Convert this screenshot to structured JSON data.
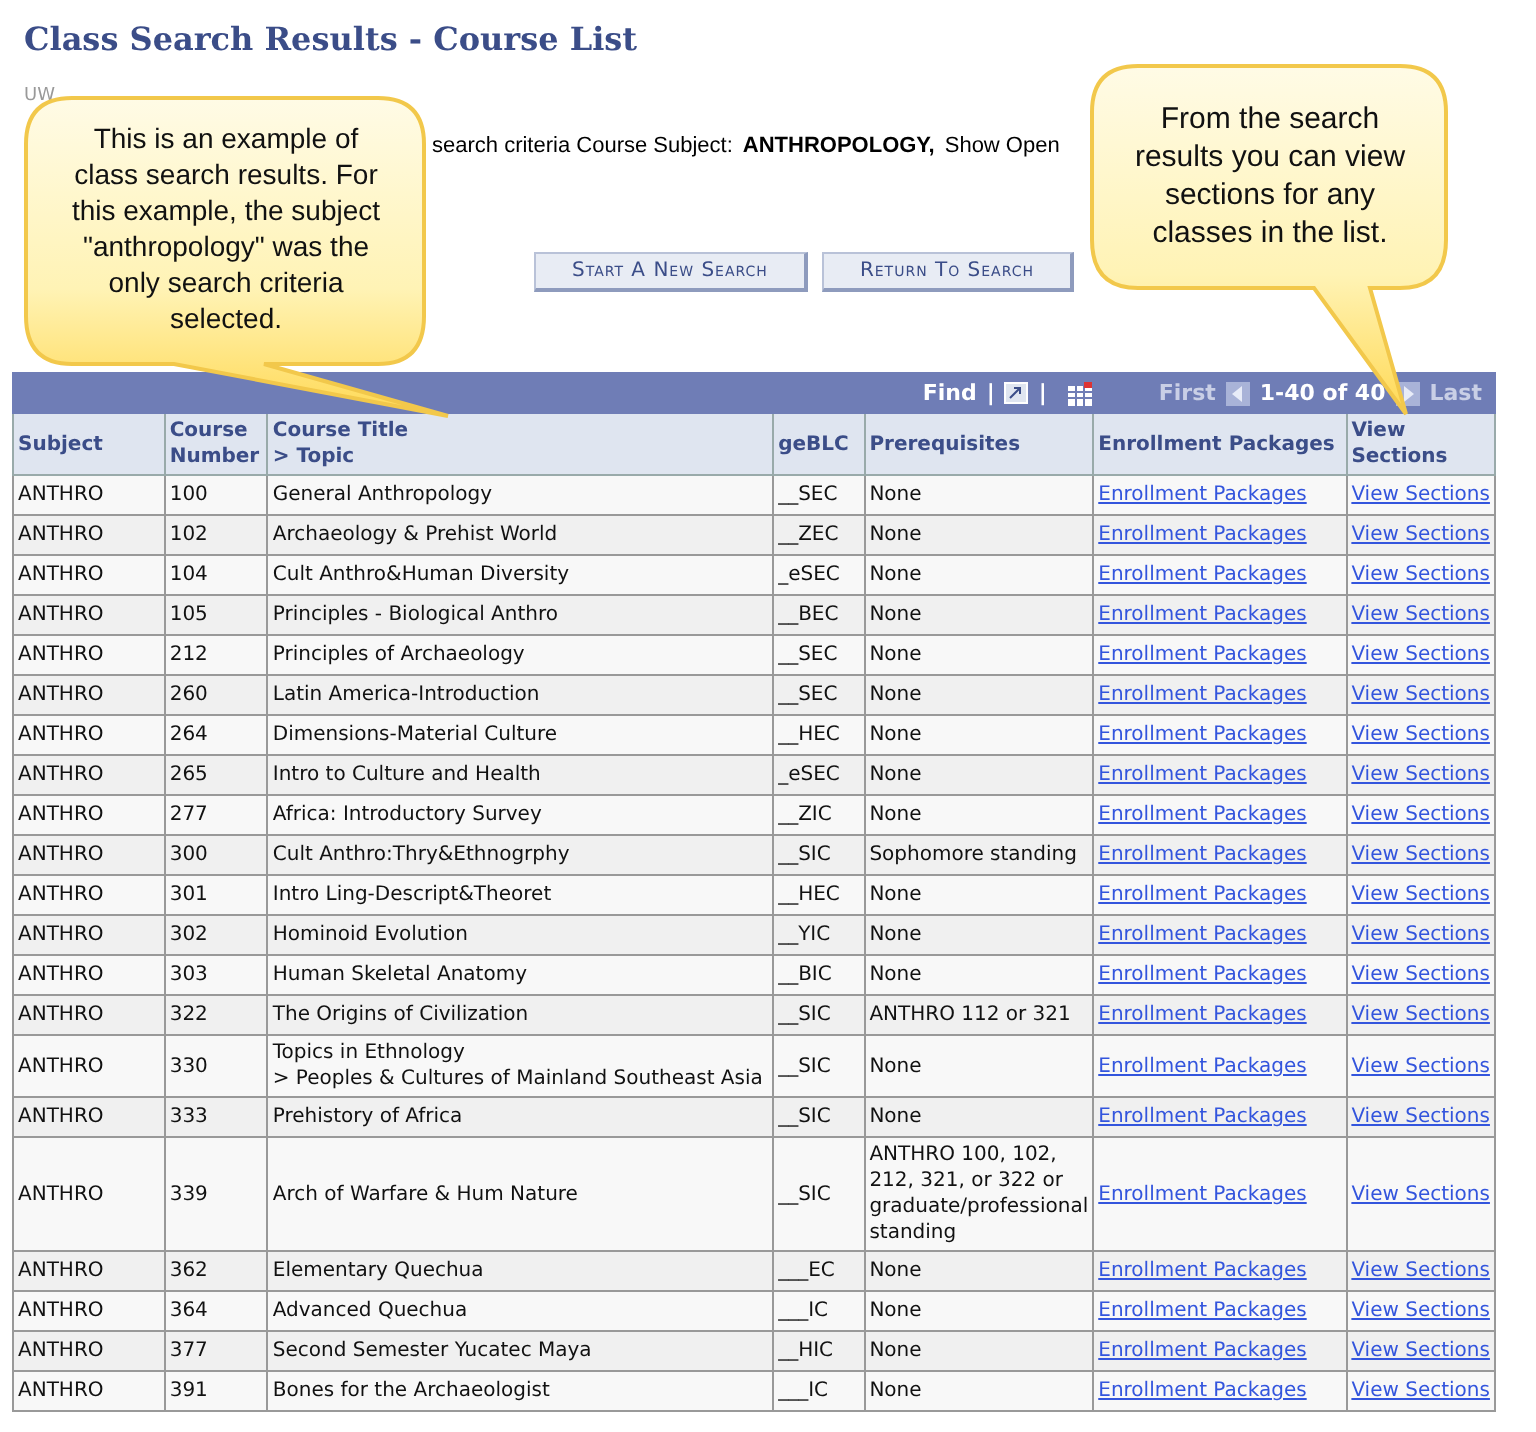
{
  "page": {
    "title": "Class Search Results - Course List",
    "institution": "UW",
    "criteria": {
      "label": "search criteria Course Subject:",
      "value": "ANTHROPOLOGY,",
      "extra": "Show Open"
    }
  },
  "buttons": [
    {
      "label": "Start A New Search"
    },
    {
      "label": "Return To Search"
    }
  ],
  "table": {
    "nav": {
      "find": "Find",
      "separators": [
        "|",
        "|"
      ],
      "first": "First",
      "range": "1-40 of 40",
      "last": "Last"
    },
    "columns": [
      {
        "label": "Subject"
      },
      {
        "label": "Course Number"
      },
      {
        "label": "Course Title",
        "sub": "> Topic"
      },
      {
        "label": "geBLC"
      },
      {
        "label": "Prerequisites"
      },
      {
        "label": "Enrollment Packages"
      },
      {
        "label": "View Sections"
      }
    ],
    "rows": [
      {
        "subject": "ANTHRO",
        "number": "100",
        "title": "General Anthropology",
        "geblc": "__SEC",
        "prereq": "None",
        "links": [
          "Enrollment Packages",
          "View Sections"
        ]
      },
      {
        "subject": "ANTHRO",
        "number": "102",
        "title": "Archaeology & Prehist World",
        "geblc": "__ZEC",
        "prereq": "None",
        "links": [
          "Enrollment Packages",
          "View Sections"
        ]
      },
      {
        "subject": "ANTHRO",
        "number": "104",
        "title": "Cult Anthro&Human Diversity",
        "geblc": "_eSEC",
        "prereq": "None",
        "links": [
          "Enrollment Packages",
          "View Sections"
        ]
      },
      {
        "subject": "ANTHRO",
        "number": "105",
        "title": "Principles - Biological Anthro",
        "geblc": "__BEC",
        "prereq": "None",
        "links": [
          "Enrollment Packages",
          "View Sections"
        ]
      },
      {
        "subject": "ANTHRO",
        "number": "212",
        "title": "Principles of Archaeology",
        "geblc": "__SEC",
        "prereq": "None",
        "links": [
          "Enrollment Packages",
          "View Sections"
        ]
      },
      {
        "subject": "ANTHRO",
        "number": "260",
        "title": "Latin America-Introduction",
        "geblc": "__SEC",
        "prereq": "None",
        "links": [
          "Enrollment Packages",
          "View Sections"
        ]
      },
      {
        "subject": "ANTHRO",
        "number": "264",
        "title": "Dimensions-Material Culture",
        "geblc": "__HEC",
        "prereq": "None",
        "links": [
          "Enrollment Packages",
          "View Sections"
        ]
      },
      {
        "subject": "ANTHRO",
        "number": "265",
        "title": "Intro to Culture and Health",
        "geblc": "_eSEC",
        "prereq": "None",
        "links": [
          "Enrollment Packages",
          "View Sections"
        ]
      },
      {
        "subject": "ANTHRO",
        "number": "277",
        "title": "Africa: Introductory Survey",
        "geblc": "__ZIC",
        "prereq": "None",
        "links": [
          "Enrollment Packages",
          "View Sections"
        ]
      },
      {
        "subject": "ANTHRO",
        "number": "300",
        "title": "Cult Anthro:Thry&Ethnogrphy",
        "geblc": "__SIC",
        "prereq": "Sophomore standing",
        "links": [
          "Enrollment Packages",
          "View Sections"
        ]
      },
      {
        "subject": "ANTHRO",
        "number": "301",
        "title": "Intro Ling-Descript&Theoret",
        "geblc": "__HEC",
        "prereq": "None",
        "links": [
          "Enrollment Packages",
          "View Sections"
        ]
      },
      {
        "subject": "ANTHRO",
        "number": "302",
        "title": "Hominoid Evolution",
        "geblc": "__YIC",
        "prereq": "None",
        "links": [
          "Enrollment Packages",
          "View Sections"
        ]
      },
      {
        "subject": "ANTHRO",
        "number": "303",
        "title": "Human Skeletal Anatomy",
        "geblc": "__BIC",
        "prereq": "None",
        "links": [
          "Enrollment Packages",
          "View Sections"
        ]
      },
      {
        "subject": "ANTHRO",
        "number": "322",
        "title": "The Origins of Civilization",
        "geblc": "__SIC",
        "prereq": "ANTHRO 112 or 321",
        "links": [
          "Enrollment Packages",
          "View Sections"
        ]
      },
      {
        "subject": "ANTHRO",
        "number": "330",
        "title": "Topics in Ethnology",
        "topic": "> Peoples & Cultures of Mainland Southeast Asia",
        "geblc": "__SIC",
        "prereq": "None",
        "links": [
          "Enrollment Packages",
          "View Sections"
        ]
      },
      {
        "subject": "ANTHRO",
        "number": "333",
        "title": "Prehistory of Africa",
        "geblc": "__SIC",
        "prereq": "None",
        "links": [
          "Enrollment Packages",
          "View Sections"
        ]
      },
      {
        "subject": "ANTHRO",
        "number": "339",
        "title": "Arch of Warfare & Hum Nature",
        "geblc": "__SIC",
        "prereq": "ANTHRO 100, 102, 212, 321, or 322 or graduate/professional standing",
        "links": [
          "Enrollment Packages",
          "View Sections"
        ]
      },
      {
        "subject": "ANTHRO",
        "number": "362",
        "title": "Elementary Quechua",
        "geblc": "___EC",
        "prereq": "None",
        "links": [
          "Enrollment Packages",
          "View Sections"
        ]
      },
      {
        "subject": "ANTHRO",
        "number": "364",
        "title": "Advanced Quechua",
        "geblc": "___IC",
        "prereq": "None",
        "links": [
          "Enrollment Packages",
          "View Sections"
        ]
      },
      {
        "subject": "ANTHRO",
        "number": "377",
        "title": "Second Semester Yucatec Maya",
        "geblc": "__HIC",
        "prereq": "None",
        "links": [
          "Enrollment Packages",
          "View Sections"
        ]
      },
      {
        "subject": "ANTHRO",
        "number": "391",
        "title": "Bones for the Archaeologist",
        "geblc": "___IC",
        "prereq": "None",
        "links": [
          "Enrollment Packages",
          "View Sections"
        ]
      }
    ]
  },
  "callouts": [
    {
      "text": "This is an example of class search results. For this example, the subject \"anthropology\" was the only search criteria selected."
    },
    {
      "text": "From the search results you can view sections for any classes in the list."
    }
  ]
}
